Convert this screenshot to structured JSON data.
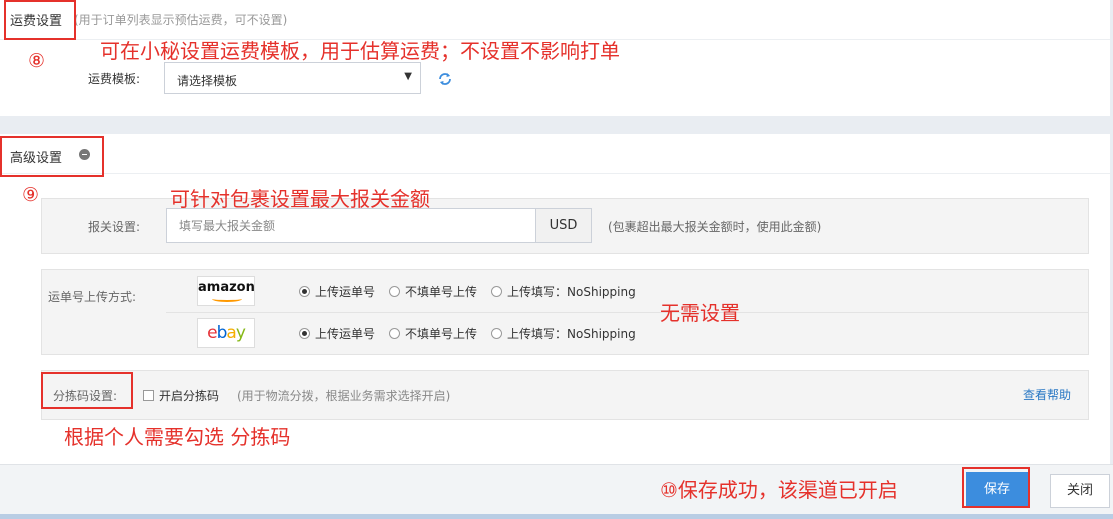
{
  "shipping_section": {
    "title": "运费设置",
    "hint": "(用于订单列表显示预估运费，可不设置)",
    "template_label": "运费模板:",
    "template_selected": "请选择模板",
    "refresh_icon": "refresh-icon"
  },
  "advanced_section": {
    "title": "高级设置",
    "toggle_icon": "minus-circle-icon",
    "customs": {
      "label": "报关设置:",
      "placeholder": "填写最大报关金额",
      "currency": "USD",
      "hint": "(包裹超出最大报关金额时，使用此金额)"
    },
    "tracking_upload": {
      "label": "运单号上传方式:",
      "platforms": [
        {
          "name": "amazon",
          "options": [
            "上传运单号",
            "不填单号上传",
            "上传填写：NoShipping"
          ],
          "selected": 0
        },
        {
          "name": "ebay",
          "options": [
            "上传运单号",
            "不填单号上传",
            "上传填写：NoShipping"
          ],
          "selected": 0
        }
      ]
    },
    "sorting": {
      "label": "分拣码设置:",
      "checkbox_label": "开启分拣码",
      "checked": false,
      "hint": "(用于物流分拨，根据业务需求选择开启)",
      "help_link": "查看帮助"
    }
  },
  "footer": {
    "save_label": "保存",
    "close_label": "关闭"
  },
  "annotations": {
    "n8": "⑧",
    "a8": "可在小秘设置运费模板，用于估算运费；不设置不影响打单",
    "n9": "⑨",
    "a9": "可针对包裹设置最大报关金额",
    "a_noneed": "无需设置",
    "a_sort": "根据个人需要勾选 分拣码",
    "a10": "⑩保存成功，该渠道已开启"
  },
  "colors": {
    "annotation_red": "#e5312b",
    "primary_blue": "#3c8dde",
    "link_blue": "#2a78c4",
    "ebay_e": "#e53238",
    "ebay_b": "#0064d2",
    "ebay_a": "#f5af02",
    "ebay_y": "#86b817",
    "amazon_orange": "#ff9900"
  }
}
